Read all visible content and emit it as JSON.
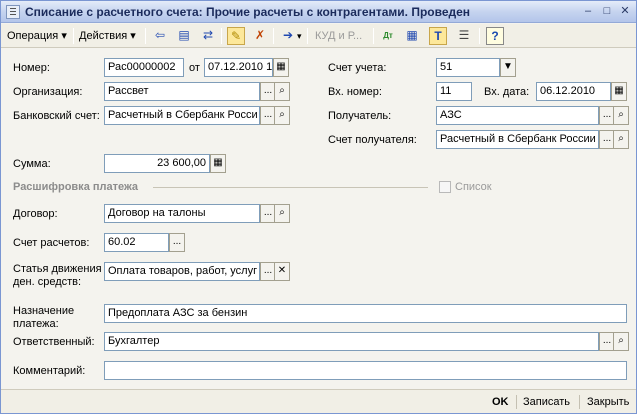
{
  "window": {
    "title": "Списание с расчетного счета: Прочие расчеты с контрагентами. Проведен",
    "controls": [
      "‒",
      "□",
      "✕"
    ]
  },
  "toolbar": {
    "operation_label": "Операция ▾",
    "actions_label": "Действия ▾",
    "kudir_label": "КУД и Р...",
    "help_label": "?"
  },
  "form": {
    "number_label": "Номер:",
    "number_value": "Рас00000002",
    "date_from_label": "от",
    "date_value": "07.12.2010 1",
    "account_label": "Счет учета:",
    "account_value": "51",
    "org_label": "Организация:",
    "org_value": "Рассвет",
    "in_number_label": "Вх. номер:",
    "in_number_value": "11",
    "in_date_label": "Вх. дата:",
    "in_date_value": "06.12.2010",
    "bank_label": "Банковский счет:",
    "bank_value": "Расчетный в Сбербанк Росси",
    "recipient_label": "Получатель:",
    "recipient_value": "АЗС",
    "recipient_account_label": "Счет получателя:",
    "recipient_account_value": "Расчетный в Сбербанк России",
    "sum_label": "Сумма:",
    "sum_value": "23 600,00",
    "section_title": "Расшифровка платежа",
    "list_label": "Список",
    "contract_label": "Договор:",
    "contract_value": "Договор на талоны",
    "settle_account_label": "Счет расчетов:",
    "settle_account_value": "60.02",
    "cashflow_label_1": "Статья движения",
    "cashflow_label_2": "ден. средств:",
    "cashflow_value": "Оплата товаров, работ, услуг",
    "purpose_label_1": "Назначение",
    "purpose_label_2": "платежа:",
    "purpose_value": "Предоплата АЗС за бензин",
    "responsible_label": "Ответственный:",
    "responsible_value": "Бухгалтер",
    "comment_label": "Комментарий:",
    "comment_value": ""
  },
  "footer": {
    "ok_label": "OK",
    "save_label": "Записать",
    "close_label": "Закрыть"
  },
  "colors": {
    "title_text": "#1b2b5c",
    "input_border": "#7f9db9",
    "section_gray": "#8c8c8c",
    "window_bg": "#f4f3ee"
  },
  "icons": [
    "window-doc-icon",
    "back-arrow-icon",
    "doc-movements-icon",
    "refresh-icon",
    "post-doc-icon",
    "unpost-doc-icon",
    "go-to-icon",
    "dt-kt-icon",
    "report-icon",
    "text-format-icon",
    "list-settings-icon",
    "help-icon",
    "calendar-icon",
    "calculator-icon",
    "search-icon",
    "ellipsis-icon",
    "clear-icon",
    "dropdown-arrow-icon"
  ]
}
